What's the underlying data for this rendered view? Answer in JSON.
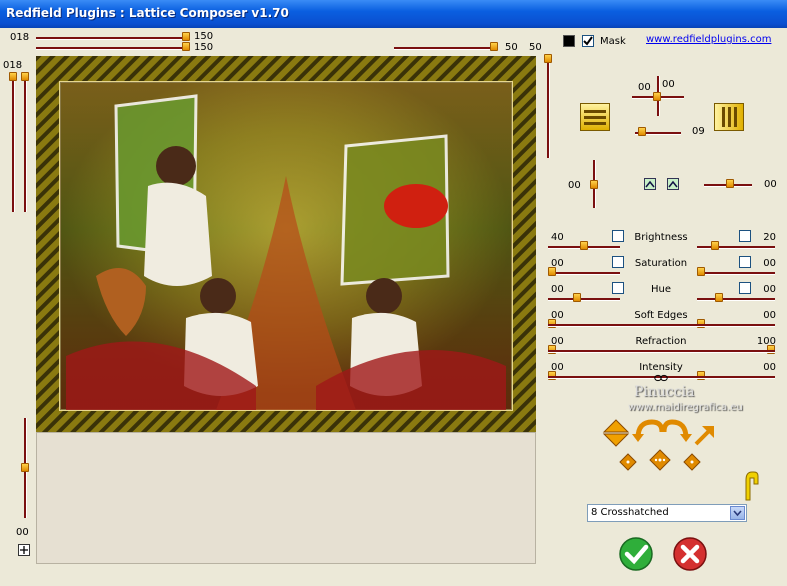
{
  "window": {
    "title": "Redfield Plugins : Lattice Composer v1.70"
  },
  "top_controls": {
    "left_value": "018",
    "slider_a_value": "150",
    "slider_b_value": "150",
    "mid_slider_value": "50",
    "mid_slider_value_b": "50",
    "mask_label": "Mask",
    "link": "www.redfieldplugins.com"
  },
  "left_rail": {
    "top_value": "018",
    "bottom_value": "00"
  },
  "lattice": {
    "center_value_a": "00",
    "center_value_b": "00",
    "right_value": "09",
    "left_value": "00",
    "far_right_value": "00"
  },
  "adjustments": [
    {
      "name": "Brightness",
      "left": "40",
      "right": "20",
      "left_level": 0.45,
      "right_level": 0.2
    },
    {
      "name": "Saturation",
      "left": "00",
      "right": "00",
      "left_level": 0.0,
      "right_level": 0.0
    },
    {
      "name": "Hue",
      "left": "00",
      "right": "00",
      "left_level": 0.35,
      "right_level": 0.25
    },
    {
      "name": "Soft Edges",
      "left": "00",
      "right": "00",
      "left_level": 0.0,
      "right_level": 0.0
    },
    {
      "name": "Refraction",
      "left": "00",
      "right": "100",
      "left_level": 0.0,
      "right_level": 1.0
    },
    {
      "name": "Intensity",
      "left": "00",
      "right": "00",
      "left_level": 0.0,
      "right_level": 0.0
    }
  ],
  "watermark": {
    "name": "Pinuccia",
    "site": "www.maidiregrafica.eu"
  },
  "preset_select": {
    "value": "8 Crosshatched"
  },
  "colors": {
    "titlebar": "#0a5fe0",
    "panel": "#ece9d8",
    "track": "#7a1010",
    "thumb": "#f0a000",
    "ok": "#2fae3a",
    "cancel": "#d43030"
  }
}
